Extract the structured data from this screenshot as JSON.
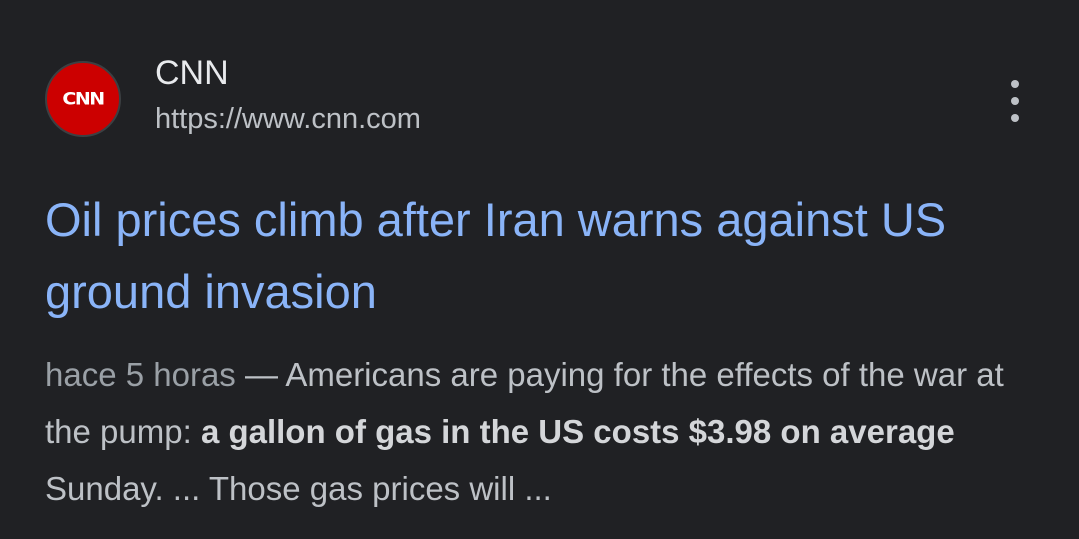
{
  "source": {
    "logo_text": "CNN",
    "name": "CNN",
    "url": "https://www.cnn.com"
  },
  "more_options_icon": "vertical-dots-icon",
  "headline": "Oil prices climb after Iran warns against US ground invasion",
  "snippet": {
    "date": "hace 5 horas",
    "separator": " — ",
    "text_1": "Americans are paying for the effects of the war at the pump: ",
    "bold": "a gallon of gas in the US costs $3.98 on average",
    "text_2": " Sunday. ... Those gas prices will ..."
  },
  "colors": {
    "background": "#202124",
    "headline_link": "#8ab4f8",
    "logo_red": "#cc0000"
  }
}
